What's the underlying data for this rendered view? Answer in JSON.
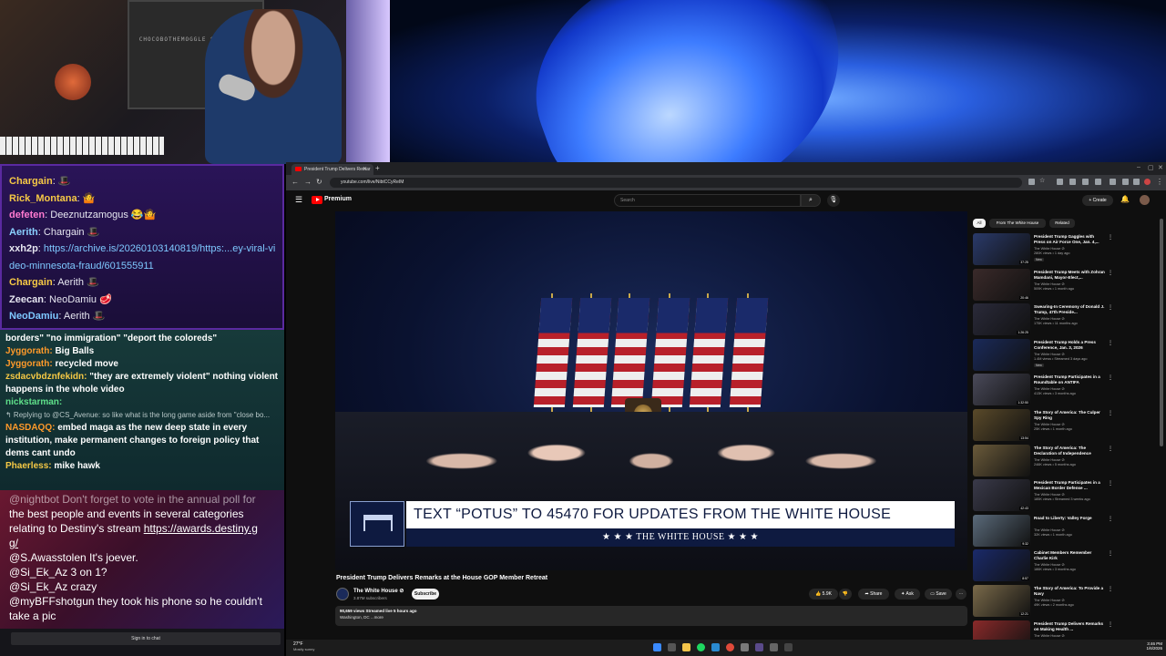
{
  "chat_top": [
    {
      "user": "Chargain",
      "text": "",
      "color": "#f6c945",
      "emote": "🎩"
    },
    {
      "user": "Rick_Montana",
      "text": "",
      "color": "#f6c945",
      "emote": "🤷"
    },
    {
      "user": "defeten",
      "text": "Deeznutzamogus",
      "color": "#ff7ad0",
      "emote": "😂🤷"
    },
    {
      "user": "Aerith",
      "text": "Chargain",
      "color": "#8ad0ff",
      "emote": "🎩"
    },
    {
      "user": "xxh2p",
      "text": "",
      "color": "#ffffff",
      "link": "https://archive.is/20260103140819/https:...ey-viral-video-minnesota-fraud/601555911"
    },
    {
      "user": "Chargain",
      "text": "Aerith",
      "color": "#f6c945",
      "emote": "🎩"
    },
    {
      "user": "Zeecan",
      "text": "NeoDamiu",
      "color": "#ffffff",
      "emote": "🥩"
    },
    {
      "user": "NeoDamiu",
      "text": "Aerith",
      "color": "#7ec8ff",
      "emote": "🎩"
    }
  ],
  "chat_mid": {
    "line0": "borders\" \"no immigration\" \"deport the coloreds\"",
    "line1_user": "Jyggorath:",
    "line1_text": "Big Balls",
    "line2_user": "Jyggorath:",
    "line2_text": "recycled move",
    "line3_user": "zsdacvbdznfekidn:",
    "line3_text": "\"they are extremely violent\" nothing violent happens in the whole video",
    "line4_user": "nickstarman:",
    "line4_text": "",
    "reply": "↰ Replying to @CS_Avenue: so like what is the long game aside from \"close bo...",
    "line5_user": "NASDAQQ:",
    "line5_text": "embed maga as the new deep state in every institution, make permanent changes to foreign policy that dems cant undo",
    "line6_user": "Phaerless:",
    "line6_text": "mike hawk"
  },
  "chat_bot": {
    "l0": "@nightbot Don't forget to vote in the annual poll for",
    "l1": "the best people and events in several categories",
    "l2": "relating to Destiny's stream ",
    "l2_link": "https://awards.destiny.g",
    "l3_link": "g/",
    "l4_user": "@S.Awasstolen",
    "l4_text": " It's joever.",
    "l5_user": "@Si_Ek_Az",
    "l5_text": " 3 on 1?",
    "l6_user": "@Si_Ek_Az",
    "l6_text": " crazy",
    "l7_user": "@myBFFshotgun",
    "l7_text": " they took his phone so he couldn't",
    "l8_text": "take a pic",
    "signin": "Sign in to chat"
  },
  "webcam": {
    "wall_text": "CHOCOBOTHEMOGGLE SUBSCRIBER"
  },
  "browser": {
    "tab_title": "President Trump Delivers Remar",
    "url": "youtube.com/live/NibtCCyReIM"
  },
  "youtube": {
    "brand": "Premium",
    "search_placeholder": "Search",
    "create": "+ Create",
    "video_title": "President Trump Delivers Remarks at the House GOP Member Retreat",
    "channel": "The White House ⊘",
    "subs": "3.87M subscribers",
    "subscribe": "Subscribe",
    "likes": "5.9K",
    "share": "Share",
    "ask": "Ask",
    "save": "Save",
    "views_line": "90,659 views  Streamed live 5 hours ago",
    "location": "Washington, DC ...more",
    "lower_third_main": "TEXT “POTUS” TO 45470 FOR UPDATES FROM THE WHITE HOUSE",
    "lower_third_sub": "★ ★ ★   THE WHITE HOUSE   ★ ★ ★",
    "chips": [
      "All",
      "From The White House",
      "Related"
    ]
  },
  "recommendations": [
    {
      "title": "President Trump Gaggles with Press on Air Force One, Jan. 4,...",
      "channel": "The White House ⊘",
      "meta": "280K views • 1 day ago",
      "badge": "New",
      "duration": "37:25",
      "color": "#2a3a6a"
    },
    {
      "title": "President Trump Meets with Zohran Mamdani, Mayor-Elect,...",
      "channel": "The White House ⊘",
      "meta": "509K views • 1 month ago",
      "badge": "",
      "duration": "20:46",
      "color": "#3a2a2a"
    },
    {
      "title": "Swearing-In Ceremony of Donald J. Trump, 47th Preside...",
      "channel": "The White House ⊘",
      "meta": "175K views • 11 months ago",
      "badge": "",
      "duration": "1:26:25",
      "color": "#2a2a3a"
    },
    {
      "title": "President Trump Holds a Press Conference, Jan. 3, 2026",
      "channel": "The White House ⊘",
      "meta": "1.4M views • Streamed 3 days ago",
      "badge": "New",
      "duration": "",
      "color": "#1a2a5a"
    },
    {
      "title": "President Trump Participates in a Roundtable on ANTIFA",
      "channel": "The White House ⊘",
      "meta": "413K views • 3 months ago",
      "badge": "",
      "duration": "1:32:50",
      "color": "#4a4a5a"
    },
    {
      "title": "The Story of America: The Culper Spy Ring",
      "channel": "The White House ⊘",
      "meta": "25K views • 1 month ago",
      "badge": "",
      "duration": "13:54",
      "color": "#5a4a2a"
    },
    {
      "title": "The Story of America: The Declaration of Independence",
      "channel": "The White House ⊘",
      "meta": "246K views • 5 months ago",
      "badge": "",
      "duration": "",
      "color": "#6a5a3a"
    },
    {
      "title": "President Trump Participates in a Mexican Border Defense ...",
      "channel": "The White House ⊘",
      "meta": "185K views • Streamed 3 weeks ago",
      "badge": "",
      "duration": "42:43",
      "color": "#3a3a4a"
    },
    {
      "title": "Road to Liberty: Valley Forge",
      "channel": "The White House ⊘",
      "meta": "32K views • 1 month ago",
      "badge": "",
      "duration": "9:32",
      "color": "#5a6a7a"
    },
    {
      "title": "Cabinet Members Remember Charlie Kirk",
      "channel": "The White House ⊘",
      "meta": "186K views • 3 months ago",
      "badge": "",
      "duration": "8:57",
      "color": "#1a2a6a"
    },
    {
      "title": "The Story of America: To Provide a Navy",
      "channel": "The White House ⊘",
      "meta": "49K views • 2 months ago",
      "badge": "",
      "duration": "12:21",
      "color": "#7a6a4a"
    },
    {
      "title": "President Trump Delivers Remarks on Making Health ...",
      "channel": "The White House ⊘",
      "meta": "",
      "badge": "",
      "duration": "",
      "color": "#8a2a2a"
    }
  ],
  "taskbar": {
    "temp": "27°F",
    "cond": "Mostly sunny",
    "time": "3:46 PM",
    "date": "1/6/2026"
  }
}
